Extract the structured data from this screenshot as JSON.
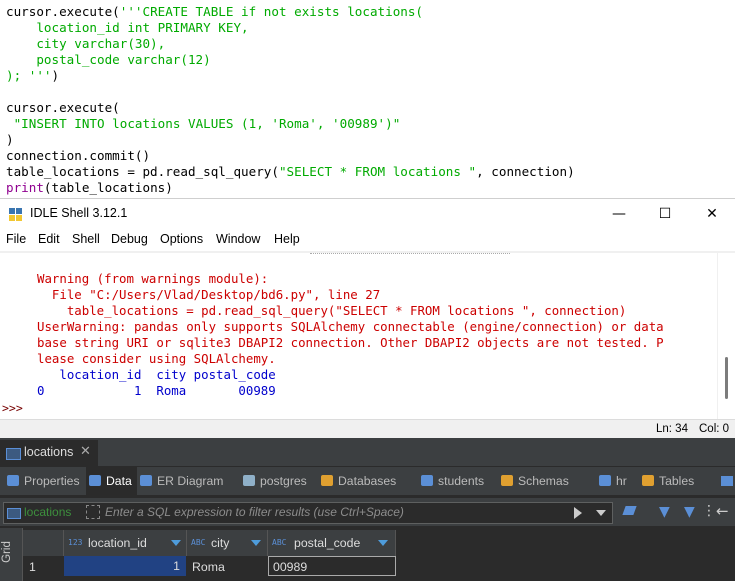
{
  "editor": {
    "lines": [
      {
        "parts": [
          {
            "t": "cursor.execute(",
            "c": ""
          },
          {
            "t": "'''CREATE TABLE if not exists locations(",
            "c": "str"
          }
        ]
      },
      {
        "parts": [
          {
            "t": "    location_id int PRIMARY KEY,",
            "c": "str"
          }
        ]
      },
      {
        "parts": [
          {
            "t": "    city varchar(30),",
            "c": "str"
          }
        ]
      },
      {
        "parts": [
          {
            "t": "    postal_code varchar(12)",
            "c": "str"
          }
        ]
      },
      {
        "parts": [
          {
            "t": "); '''",
            "c": "str"
          },
          {
            "t": ")",
            "c": ""
          }
        ]
      },
      {
        "parts": [
          {
            "t": "",
            "c": ""
          }
        ]
      },
      {
        "parts": [
          {
            "t": "cursor.execute(",
            "c": ""
          }
        ]
      },
      {
        "parts": [
          {
            "t": " ",
            "c": ""
          },
          {
            "t": "\"INSERT INTO locations VALUES (1, 'Roma', '00989')\"",
            "c": "str"
          }
        ]
      },
      {
        "parts": [
          {
            "t": ")",
            "c": ""
          }
        ]
      },
      {
        "parts": [
          {
            "t": "connection.commit()",
            "c": ""
          }
        ]
      },
      {
        "parts": [
          {
            "t": "table_locations = pd.read_sql_query(",
            "c": ""
          },
          {
            "t": "\"SELECT * FROM locations \"",
            "c": "str"
          },
          {
            "t": ", connection)",
            "c": ""
          }
        ]
      },
      {
        "parts": [
          {
            "t": "print",
            "c": "bi"
          },
          {
            "t": "(table_locations)",
            "c": ""
          }
        ]
      }
    ]
  },
  "idle": {
    "title": "IDLE Shell 3.12.1",
    "window_buttons": {
      "minimize": "—",
      "maximize": "☐",
      "close": "✕"
    },
    "menu": [
      "File",
      "Edit",
      "Shell",
      "Debug",
      "Options",
      "Window",
      "Help"
    ],
    "output": [
      {
        "t": "Warning (from warnings module):",
        "c": "red"
      },
      {
        "t": "  File \"C:/Users/Vlad/Desktop/bd6.py\", line 27",
        "c": "red"
      },
      {
        "t": "    table_locations = pd.read_sql_query(\"SELECT * FROM locations \", connection)",
        "c": "red"
      },
      {
        "t": "UserWarning: pandas only supports SQLAlchemy connectable (engine/connection) or data",
        "c": "red"
      },
      {
        "t": "base string URI or sqlite3 DBAPI2 connection. Other DBAPI2 objects are not tested. P",
        "c": "red"
      },
      {
        "t": "lease consider using SQLAlchemy.",
        "c": "red"
      },
      {
        "t": "   location_id  city postal_code",
        "c": "blue"
      },
      {
        "t": "0            1  Roma       00989",
        "c": "blue"
      }
    ],
    "prompt": ">>>",
    "status": {
      "line": "Ln: 34",
      "col": "Col: 0"
    }
  },
  "dbeaver": {
    "doc_tab": "locations",
    "subtabs": [
      {
        "label": "Properties",
        "icon_color": "#5b8fd6"
      },
      {
        "label": "Data",
        "icon_color": "#5b8fd6"
      },
      {
        "label": "ER Diagram",
        "icon_color": "#5b8fd6"
      },
      {
        "label": "postgres",
        "icon_color": "#8fb0c8"
      },
      {
        "label": "Databases",
        "icon_color": "#e0a030"
      },
      {
        "label": "students",
        "icon_color": "#5b8fd6"
      },
      {
        "label": "Schemas",
        "icon_color": "#e0a030"
      },
      {
        "label": "hr",
        "icon_color": "#5b8fd6"
      },
      {
        "label": "Tables",
        "icon_color": "#e0a030"
      }
    ],
    "filter": {
      "table_label": "locations",
      "placeholder": "Enter a SQL expression to filter results (use Ctrl+Space)"
    },
    "grid_label": "Grid",
    "columns": [
      {
        "type": "123",
        "name": "location_id"
      },
      {
        "type": "ABC",
        "name": "city"
      },
      {
        "type": "ABC",
        "name": "postal_code"
      }
    ],
    "rows": [
      {
        "num": "1",
        "location_id": "1",
        "city": "Roma",
        "postal_code": "00989"
      }
    ]
  }
}
